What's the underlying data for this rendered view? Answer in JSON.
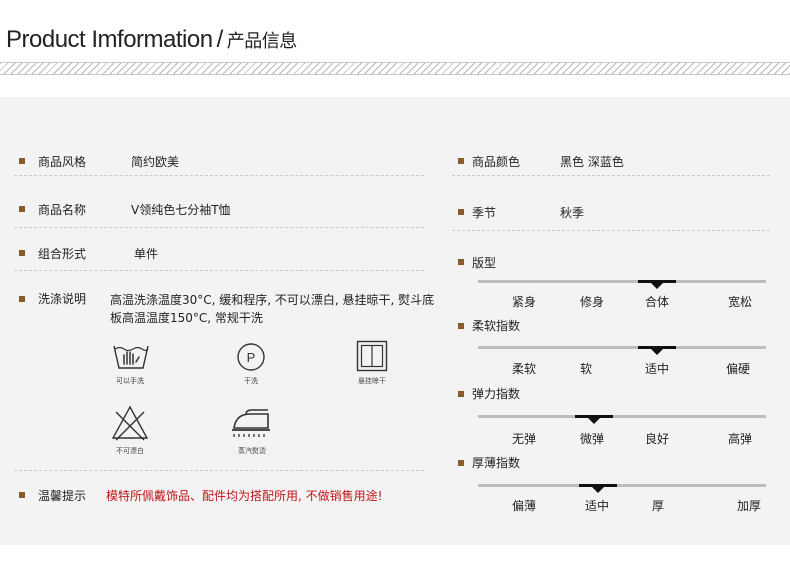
{
  "header": {
    "title_en": "Product Imformation",
    "separator": "/",
    "title_zh": "产品信息"
  },
  "left": {
    "style": {
      "label": "商品风格",
      "value": "简约欧美"
    },
    "name": {
      "label": "商品名称",
      "value": "V领纯色七分袖T恤"
    },
    "form": {
      "label": "组合形式",
      "value": "单件"
    },
    "wash": {
      "label": "洗涤说明",
      "text": "高温洗涤温度30°C, 缓和程序, 不可以漂白, 悬挂晾干, 熨斗底板高温温度150°C, 常规干洗",
      "icons": [
        {
          "icon": "hand-wash-icon",
          "caption": "可以手洗"
        },
        {
          "icon": "dry-clean-p-icon",
          "caption": "干洗"
        },
        {
          "icon": "hang-dry-icon",
          "caption": "悬挂晾干"
        },
        {
          "icon": "no-bleach-icon",
          "caption": "不可漂白"
        },
        {
          "icon": "steam-iron-icon",
          "caption": "蒸汽熨烫"
        }
      ]
    },
    "tip": {
      "label": "温馨提示",
      "value": "模特所佩戴饰品、配件均为搭配所用, 不做销售用途!"
    }
  },
  "right": {
    "color": {
      "label": "商品颜色",
      "value": "黑色 深蓝色"
    },
    "season": {
      "label": "季节",
      "value": "秋季"
    },
    "fit": {
      "label": "版型",
      "options": [
        "紧身",
        "修身",
        "合体",
        "宽松"
      ],
      "selected": "合体"
    },
    "softness": {
      "label": "柔软指数",
      "options": [
        "柔软",
        "软",
        "适中",
        "偏硬"
      ],
      "selected": "适中"
    },
    "elasticity": {
      "label": "弹力指数",
      "options": [
        "无弹",
        "微弹",
        "良好",
        "高弹"
      ],
      "selected": "微弹"
    },
    "thickness": {
      "label": "厚薄指数",
      "options": [
        "偏薄",
        "适中",
        "厚",
        "加厚"
      ],
      "selected": "适中"
    }
  },
  "colors": {
    "bullet": "#8a5a2b",
    "warning": "#c0151b",
    "panel": "#f3f3f3"
  }
}
